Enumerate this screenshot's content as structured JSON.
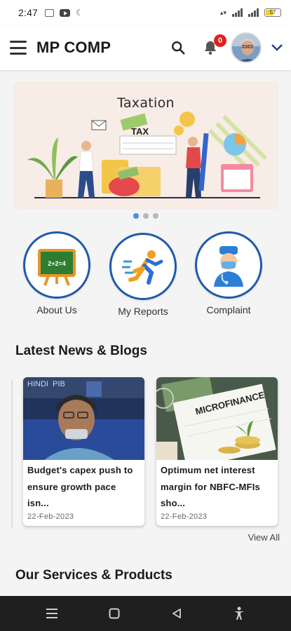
{
  "status_bar": {
    "time": "2:47",
    "battery": "57"
  },
  "header": {
    "title": "MP COMP",
    "notification_count": "0"
  },
  "banner": {
    "title": "Taxation",
    "tax_label": "TAX"
  },
  "carousel": {
    "dot_count": 3,
    "active_index": 0
  },
  "quick_actions": [
    {
      "label": "About Us",
      "icon": "easel-board-icon"
    },
    {
      "label": "My Reports",
      "icon": "running-person-icon"
    },
    {
      "label": "Complaint",
      "icon": "doctor-icon"
    }
  ],
  "about_us_board_text": "2+2=4",
  "news": {
    "section_title": "Latest News & Blogs",
    "items": [
      {
        "title": "Budget's capex push to ensure growth pace isn...",
        "title_lines": [
          "Budget's capex push to",
          "ensure growth pace",
          "isn..."
        ],
        "date": "22-Feb-2023",
        "image_text": "HINDI  PIB"
      },
      {
        "title": "Optimum net interest margin for NBFC-MFIs sho...",
        "title_lines": [
          "Optimum net interest",
          "margin for NBFC-MFIs",
          "sho..."
        ],
        "date": "22-Feb-2023",
        "image_text": "MICROFINANCE"
      }
    ],
    "view_all_label": "View All"
  },
  "services": {
    "section_title": "Our Services & Products"
  },
  "colors": {
    "accent": "#1f5aa8",
    "badge": "#e02020",
    "dot_active": "#4a90e2",
    "nav_bar": "#1f1f1f"
  }
}
